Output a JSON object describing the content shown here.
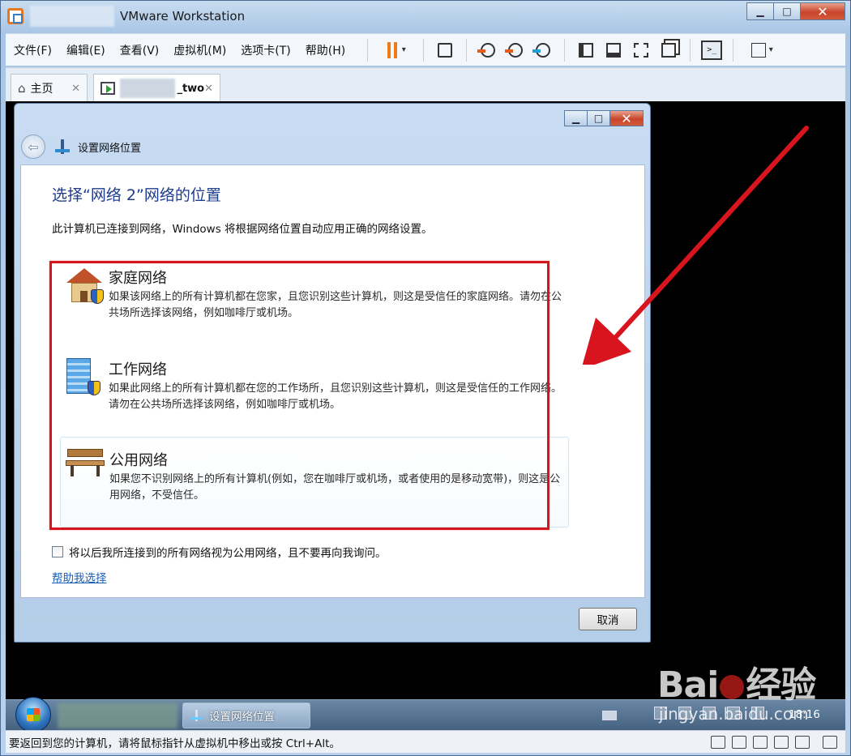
{
  "app": {
    "title": "VMware Workstation",
    "window_controls": {
      "minimize": "▁",
      "maximize": "□",
      "close": "✕"
    }
  },
  "menu": [
    "文件(F)",
    "编辑(E)",
    "查看(V)",
    "虚拟机(M)",
    "选项卡(T)",
    "帮助(H)"
  ],
  "toolbar": {
    "icons": [
      "pause-icon",
      "send-keys-icon",
      "snapshot-icon",
      "revert-snapshot-icon",
      "snapshot-manager-icon",
      "library-icon",
      "thumbnail-icon",
      "fullscreen-icon",
      "unity-icon",
      "console-icon",
      "stretch-icon"
    ],
    "console_glyph": ">_",
    "dropdown_glyph": "▾"
  },
  "tabs": {
    "home": {
      "label": "主页",
      "close": "✕"
    },
    "vm": {
      "label": "_two",
      "close": "✕"
    }
  },
  "dialog": {
    "title": "设置网络位置",
    "back_glyph": "⇦",
    "controls": {
      "minimize": "▁",
      "maximize": "□",
      "close": "✕"
    },
    "heading": "选择“网络 2”网络的位置",
    "description": "此计算机已连接到网络，Windows 将根据网络位置自动应用正确的网络设置。",
    "options": [
      {
        "title": "家庭网络",
        "desc": "如果该网络上的所有计算机都在您家，且您识别这些计算机，则这是受信任的家庭网络。请勿在公共场所选择该网络，例如咖啡厅或机场。",
        "icon": "house-icon"
      },
      {
        "title": "工作网络",
        "desc": "如果此网络上的所有计算机都在您的工作场所，且您识别这些计算机，则这是受信任的工作网络。请勿在公共场所选择该网络，例如咖啡厅或机场。",
        "icon": "office-icon"
      },
      {
        "title": "公用网络",
        "desc": "如果您不识别网络上的所有计算机(例如，您在咖啡厅或机场，或者使用的是移动宽带)，则这是公用网络，不受信任。",
        "icon": "bench-icon"
      }
    ],
    "checkbox_label": "将以后我所连接到的所有网络视为公用网络，且不要再向我询问。",
    "checkbox_checked": false,
    "help_link": "帮助我选择",
    "cancel_button": "取消"
  },
  "guest_taskbar": {
    "task_label": "设置网络位置",
    "clock": "18:16"
  },
  "statusbar": {
    "text": "要返回到您的计算机，请将鼠标指针从虚拟机中移出或按 Ctrl+Alt。"
  },
  "watermark": {
    "brand_left": "Bai",
    "brand_right": "经验",
    "url": "jingyan.baidu.com"
  },
  "colors": {
    "annotation_red": "#d8141e",
    "heading_blue": "#1e3c8c",
    "link_blue": "#1a5fb4",
    "pause_orange": "#ef7a1a"
  }
}
